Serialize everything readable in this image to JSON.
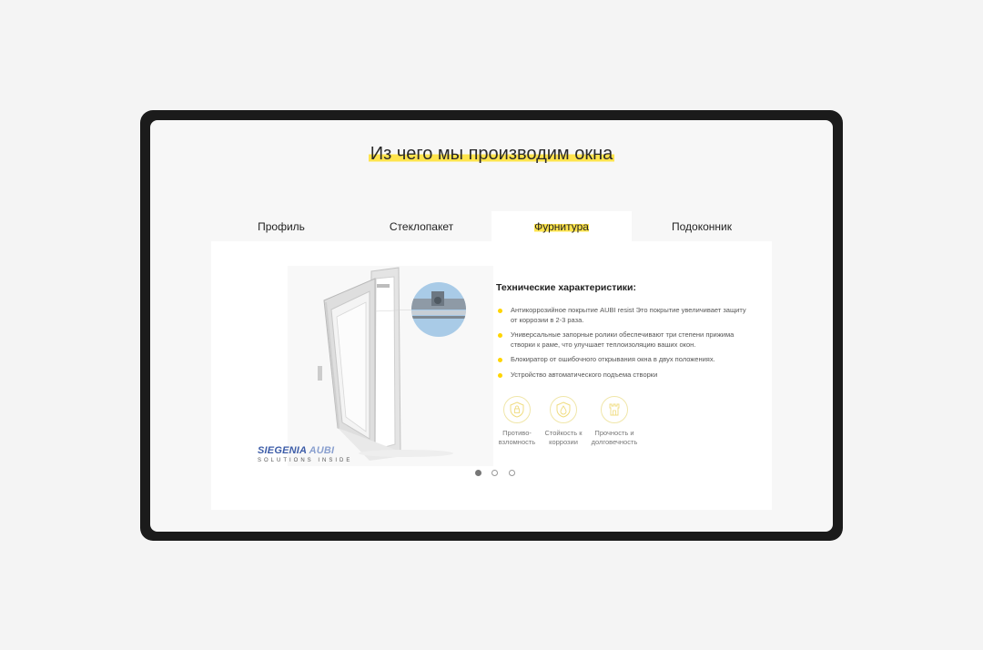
{
  "page": {
    "title": "Из чего мы производим окна"
  },
  "tabs": [
    {
      "label": "Профиль",
      "active": false
    },
    {
      "label": "Стеклопакет",
      "active": false
    },
    {
      "label": "Фурнитура",
      "active": true
    },
    {
      "label": "Подоконник",
      "active": false
    }
  ],
  "product": {
    "image_icon": "window-hardware-photo",
    "brand_main": "SIEGENIA",
    "brand_accent": "AUBI",
    "brand_tagline": "SOLUTIONS INSIDE"
  },
  "specs": {
    "title": "Технические характеристики:",
    "items": [
      "Антикоррозийное покрытие AUBI resist Это покрытие увеличивает защиту от коррозии в 2-3 раза.",
      "Универсальные запорные ролики обеспечивают три степени прижима створки к раме, что улучшает теплоизоляцию ваших окон.",
      "Блокиратор от ошибочного открывания окна в двух положениях.",
      "Устройство автоматического подъема створки"
    ]
  },
  "features": [
    {
      "icon": "lock-shield-icon",
      "label_line1": "Противо-",
      "label_line2": "взломность"
    },
    {
      "icon": "drop-shield-icon",
      "label_line1": "Стойкость к",
      "label_line2": "коррозии"
    },
    {
      "icon": "tower-icon",
      "label_line1": "Прочность и",
      "label_line2": "долговечность"
    }
  ],
  "carousel": {
    "count": 3,
    "active_index": 0
  },
  "colors": {
    "accent": "#ffe44d",
    "bullet": "#ffd500",
    "brand": "#3d5da8",
    "frame": "#1b1b1b"
  }
}
